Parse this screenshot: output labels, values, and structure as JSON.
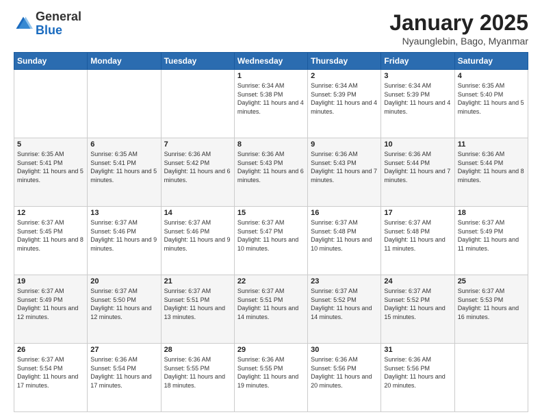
{
  "header": {
    "logo_general": "General",
    "logo_blue": "Blue",
    "month_title": "January 2025",
    "subtitle": "Nyaunglebin, Bago, Myanmar"
  },
  "days_of_week": [
    "Sunday",
    "Monday",
    "Tuesday",
    "Wednesday",
    "Thursday",
    "Friday",
    "Saturday"
  ],
  "weeks": [
    [
      {
        "num": "",
        "info": ""
      },
      {
        "num": "",
        "info": ""
      },
      {
        "num": "",
        "info": ""
      },
      {
        "num": "1",
        "info": "Sunrise: 6:34 AM\nSunset: 5:38 PM\nDaylight: 11 hours and 4 minutes."
      },
      {
        "num": "2",
        "info": "Sunrise: 6:34 AM\nSunset: 5:39 PM\nDaylight: 11 hours and 4 minutes."
      },
      {
        "num": "3",
        "info": "Sunrise: 6:34 AM\nSunset: 5:39 PM\nDaylight: 11 hours and 4 minutes."
      },
      {
        "num": "4",
        "info": "Sunrise: 6:35 AM\nSunset: 5:40 PM\nDaylight: 11 hours and 5 minutes."
      }
    ],
    [
      {
        "num": "5",
        "info": "Sunrise: 6:35 AM\nSunset: 5:41 PM\nDaylight: 11 hours and 5 minutes."
      },
      {
        "num": "6",
        "info": "Sunrise: 6:35 AM\nSunset: 5:41 PM\nDaylight: 11 hours and 5 minutes."
      },
      {
        "num": "7",
        "info": "Sunrise: 6:36 AM\nSunset: 5:42 PM\nDaylight: 11 hours and 6 minutes."
      },
      {
        "num": "8",
        "info": "Sunrise: 6:36 AM\nSunset: 5:43 PM\nDaylight: 11 hours and 6 minutes."
      },
      {
        "num": "9",
        "info": "Sunrise: 6:36 AM\nSunset: 5:43 PM\nDaylight: 11 hours and 7 minutes."
      },
      {
        "num": "10",
        "info": "Sunrise: 6:36 AM\nSunset: 5:44 PM\nDaylight: 11 hours and 7 minutes."
      },
      {
        "num": "11",
        "info": "Sunrise: 6:36 AM\nSunset: 5:44 PM\nDaylight: 11 hours and 8 minutes."
      }
    ],
    [
      {
        "num": "12",
        "info": "Sunrise: 6:37 AM\nSunset: 5:45 PM\nDaylight: 11 hours and 8 minutes."
      },
      {
        "num": "13",
        "info": "Sunrise: 6:37 AM\nSunset: 5:46 PM\nDaylight: 11 hours and 9 minutes."
      },
      {
        "num": "14",
        "info": "Sunrise: 6:37 AM\nSunset: 5:46 PM\nDaylight: 11 hours and 9 minutes."
      },
      {
        "num": "15",
        "info": "Sunrise: 6:37 AM\nSunset: 5:47 PM\nDaylight: 11 hours and 10 minutes."
      },
      {
        "num": "16",
        "info": "Sunrise: 6:37 AM\nSunset: 5:48 PM\nDaylight: 11 hours and 10 minutes."
      },
      {
        "num": "17",
        "info": "Sunrise: 6:37 AM\nSunset: 5:48 PM\nDaylight: 11 hours and 11 minutes."
      },
      {
        "num": "18",
        "info": "Sunrise: 6:37 AM\nSunset: 5:49 PM\nDaylight: 11 hours and 11 minutes."
      }
    ],
    [
      {
        "num": "19",
        "info": "Sunrise: 6:37 AM\nSunset: 5:49 PM\nDaylight: 11 hours and 12 minutes."
      },
      {
        "num": "20",
        "info": "Sunrise: 6:37 AM\nSunset: 5:50 PM\nDaylight: 11 hours and 12 minutes."
      },
      {
        "num": "21",
        "info": "Sunrise: 6:37 AM\nSunset: 5:51 PM\nDaylight: 11 hours and 13 minutes."
      },
      {
        "num": "22",
        "info": "Sunrise: 6:37 AM\nSunset: 5:51 PM\nDaylight: 11 hours and 14 minutes."
      },
      {
        "num": "23",
        "info": "Sunrise: 6:37 AM\nSunset: 5:52 PM\nDaylight: 11 hours and 14 minutes."
      },
      {
        "num": "24",
        "info": "Sunrise: 6:37 AM\nSunset: 5:52 PM\nDaylight: 11 hours and 15 minutes."
      },
      {
        "num": "25",
        "info": "Sunrise: 6:37 AM\nSunset: 5:53 PM\nDaylight: 11 hours and 16 minutes."
      }
    ],
    [
      {
        "num": "26",
        "info": "Sunrise: 6:37 AM\nSunset: 5:54 PM\nDaylight: 11 hours and 17 minutes."
      },
      {
        "num": "27",
        "info": "Sunrise: 6:36 AM\nSunset: 5:54 PM\nDaylight: 11 hours and 17 minutes."
      },
      {
        "num": "28",
        "info": "Sunrise: 6:36 AM\nSunset: 5:55 PM\nDaylight: 11 hours and 18 minutes."
      },
      {
        "num": "29",
        "info": "Sunrise: 6:36 AM\nSunset: 5:55 PM\nDaylight: 11 hours and 19 minutes."
      },
      {
        "num": "30",
        "info": "Sunrise: 6:36 AM\nSunset: 5:56 PM\nDaylight: 11 hours and 20 minutes."
      },
      {
        "num": "31",
        "info": "Sunrise: 6:36 AM\nSunset: 5:56 PM\nDaylight: 11 hours and 20 minutes."
      },
      {
        "num": "",
        "info": ""
      }
    ]
  ]
}
